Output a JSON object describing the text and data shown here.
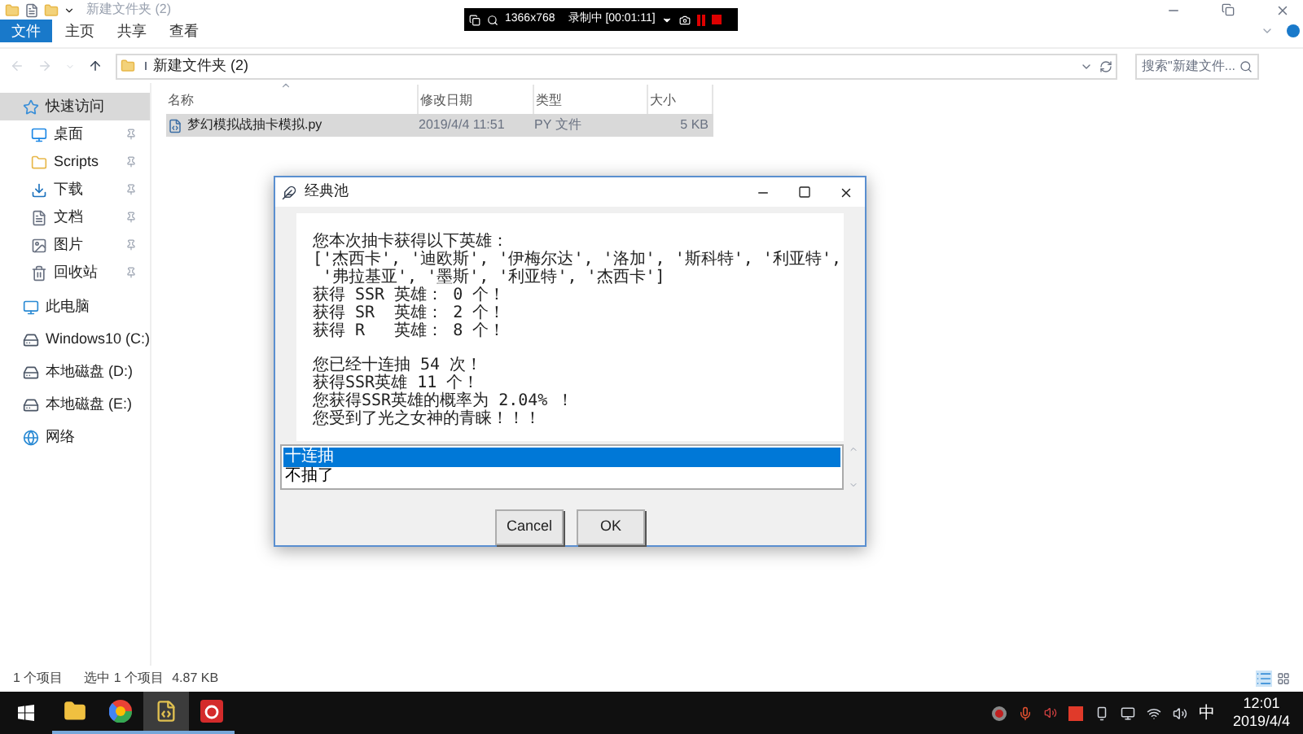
{
  "window": {
    "title": "新建文件夹 (2)"
  },
  "recorder": {
    "resolution": "1366x768",
    "status": "录制中 [00:01:11]"
  },
  "ribbon_tabs": [
    {
      "label": "文件",
      "kind": "file"
    },
    {
      "label": "主页",
      "kind": "tab"
    },
    {
      "label": "共享",
      "kind": "tab"
    },
    {
      "label": "查看",
      "kind": "tab"
    }
  ],
  "address": {
    "path": "新建文件夹 (2)"
  },
  "search": {
    "placeholder": "搜索\"新建文件..."
  },
  "sidebar": {
    "items": [
      {
        "label": "快速访问",
        "kind": "star",
        "selected": true,
        "children": [
          {
            "label": "桌面",
            "kind": "desktop",
            "selected": false,
            "pinned": true
          },
          {
            "label": "Scripts",
            "kind": "folder",
            "selected": false,
            "pinned": true
          },
          {
            "label": "下载",
            "kind": "download",
            "selected": false,
            "pinned": true
          },
          {
            "label": "文档",
            "kind": "document",
            "selected": false,
            "pinned": true
          },
          {
            "label": "图片",
            "kind": "picture",
            "selected": false,
            "pinned": true
          },
          {
            "label": "回收站",
            "kind": "recycle",
            "selected": false,
            "pinned": true
          }
        ]
      },
      {
        "label": "此电脑",
        "kind": "pc",
        "selected": false
      },
      {
        "label": "Windows10 (C:)",
        "kind": "drive",
        "selected": false
      },
      {
        "label": "本地磁盘 (D:)",
        "kind": "drive",
        "selected": false
      },
      {
        "label": "本地磁盘 (E:)",
        "kind": "drive",
        "selected": false
      },
      {
        "label": "网络",
        "kind": "network",
        "selected": false
      }
    ]
  },
  "table": {
    "columns": [
      "名称",
      "修改日期",
      "类型",
      "大小"
    ],
    "rows": [
      {
        "name": "梦幻模拟战抽卡模拟.py",
        "date": "2019/4/4 11:51",
        "type": "PY 文件",
        "size": "5 KB",
        "selected": true
      }
    ]
  },
  "status_bar": {
    "count": "1 个项目",
    "selection": "选中 1 个项目",
    "size": "4.87 KB"
  },
  "dialog": {
    "title": "经典池",
    "paragraphs": [
      [
        "您本次抽卡获得以下英雄：",
        "['杰西卡', '迪欧斯', '伊梅尔达', '洛加', '斯科特', '利亚特',",
        " '弗拉基亚', '墨斯', '利亚特', '杰西卡']",
        "获得 SSR 英雄： 0 个！",
        "获得 SR  英雄： 2 个！",
        "获得 R   英雄： 8 个！"
      ],
      [
        "您已经十连抽 54 次！",
        "获得SSR英雄 11 个！",
        "您获得SSR英雄的概率为 2.04% ！",
        "您受到了光之女神的青睐！！！"
      ]
    ],
    "options": [
      {
        "label": "十连抽",
        "selected": true
      },
      {
        "label": "不抽了",
        "selected": false
      }
    ],
    "buttons": [
      "Cancel",
      "OK"
    ]
  },
  "taskbar": {
    "apps": [
      {
        "kind": "explorer",
        "selected": false
      },
      {
        "kind": "ball",
        "selected": false
      },
      {
        "kind": "python",
        "selected": true
      },
      {
        "kind": "music",
        "selected": false
      }
    ],
    "tray": {
      "ime": "中",
      "time": "12:01",
      "date": "2019/4/4"
    }
  }
}
